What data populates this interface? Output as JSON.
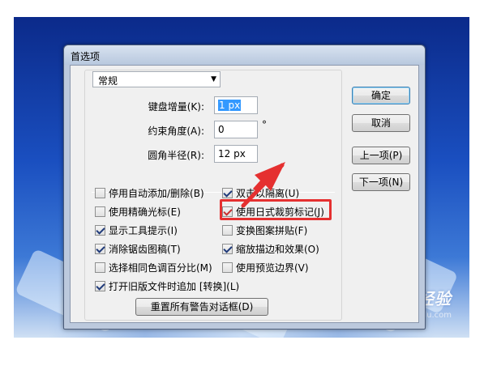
{
  "window": {
    "title": "首选项"
  },
  "section_select": {
    "value": "常规"
  },
  "fields": [
    {
      "label": "键盘增量(K):",
      "value": "1 px",
      "selected": true
    },
    {
      "label": "约束角度(A):",
      "value": "0",
      "unit": "°"
    },
    {
      "label": "圆角半径(R):",
      "value": "12 px"
    }
  ],
  "options_left": [
    {
      "label": "停用自动添加/删除(B)",
      "checked": false
    },
    {
      "label": "使用精确光标(E)",
      "checked": false
    },
    {
      "label": "显示工具提示(I)",
      "checked": true
    },
    {
      "label": "消除锯齿图稿(T)",
      "checked": true
    },
    {
      "label": "选择相同色调百分比(M)",
      "checked": false
    },
    {
      "label": "打开旧版文件时追加 [转换](L)",
      "checked": true
    }
  ],
  "options_right": [
    {
      "label": "双击以隔离(U)",
      "checked": true
    },
    {
      "label": "使用日式裁剪标记(J)",
      "checked": true
    },
    {
      "label": "变换图案拼贴(F)",
      "checked": false
    },
    {
      "label": "缩放描边和效果(O)",
      "checked": true
    },
    {
      "label": "使用预览边界(V)",
      "checked": false
    }
  ],
  "buttons": {
    "ok": "确定",
    "cancel": "取消",
    "prev": "上一项(P)",
    "next": "下一项(N)",
    "reset_warnings": "重置所有警告对话框(D)"
  },
  "annotation": {
    "color": "#e53030"
  },
  "watermark": {
    "logo": "Baidu经验",
    "url": "jingyan.baidu.com"
  }
}
